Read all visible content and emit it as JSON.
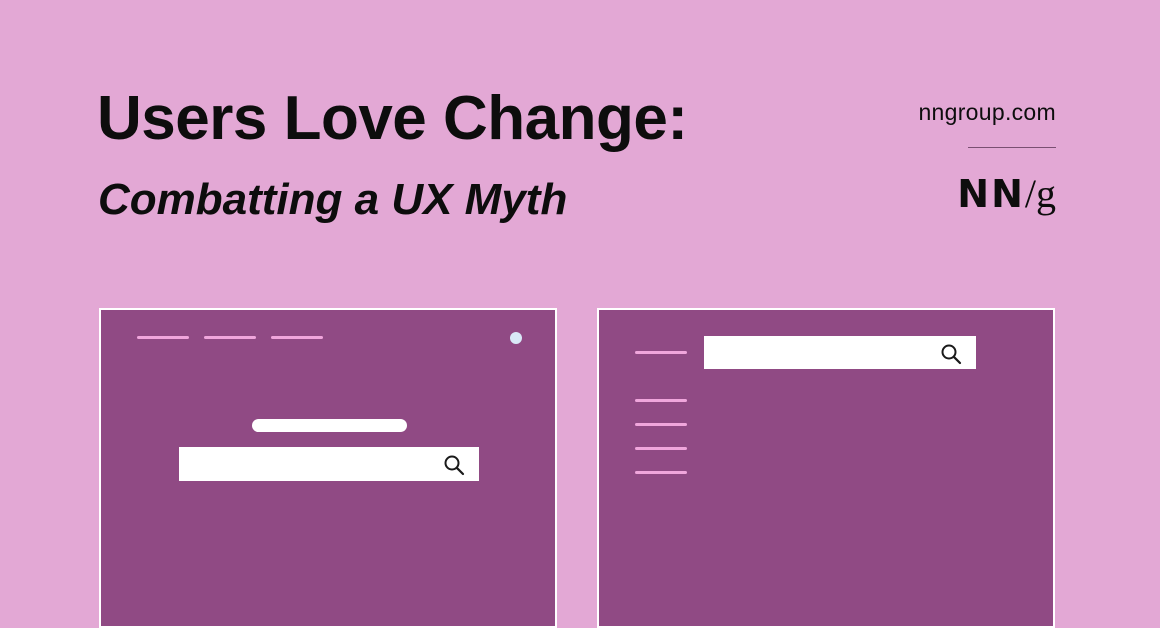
{
  "header": {
    "title": "Users Love Change:",
    "subtitle": "Combatting a UX Myth"
  },
  "brand": {
    "site": "nngroup.com",
    "logo_main": "NN",
    "logo_slash": "/",
    "logo_suffix": "g"
  },
  "illustration": {
    "left_panel": {
      "nav_link_count": 3,
      "icons": [
        "profile-dot-icon",
        "search-icon"
      ]
    },
    "right_panel": {
      "sidebar_link_count": 5,
      "icons": [
        "search-icon"
      ]
    }
  },
  "colors": {
    "background": "#e3a8d5",
    "panel": "#904a84",
    "panel_border": "#ffffff",
    "nav_lines": "#f0a6dc",
    "text": "#0d0d0d"
  }
}
